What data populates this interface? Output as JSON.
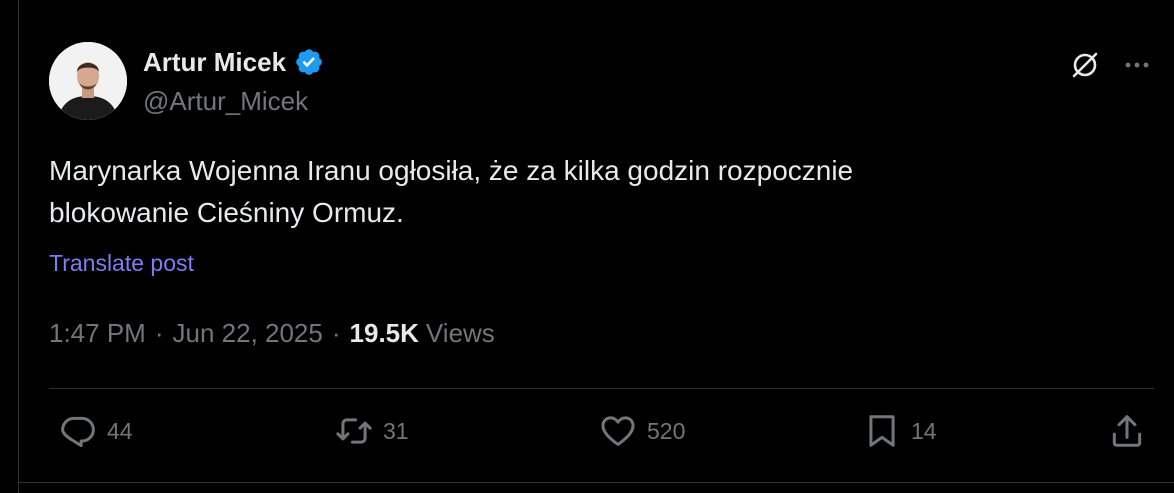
{
  "author": {
    "display_name": "Artur Micek",
    "handle": "@Artur_Micek"
  },
  "post": {
    "text_line1": "Marynarka Wojenna Iranu ogłosiła, że za kilka godzin rozpocznie",
    "text_line2": "blokowanie Cieśniny Ormuz.",
    "translate_label": "Translate post",
    "time": "1:47 PM",
    "date": "Jun 22, 2025",
    "separator": "·",
    "views_count": "19.5K",
    "views_label": "Views"
  },
  "actions": {
    "replies": "44",
    "reposts": "31",
    "likes": "520",
    "bookmarks": "14"
  },
  "icons": {
    "verified": "verified-badge-icon",
    "grok": "grok-icon",
    "more": "more-horizontal-icon",
    "reply": "reply-icon",
    "repost": "repost-icon",
    "like": "heart-icon",
    "bookmark": "bookmark-icon",
    "share": "share-icon"
  },
  "colors": {
    "background": "#000000",
    "primary_text": "#e7e9ea",
    "secondary_text": "#71767b",
    "link": "#7c7ff2",
    "verified": "#1d9bf0",
    "divider": "#2f3336"
  }
}
